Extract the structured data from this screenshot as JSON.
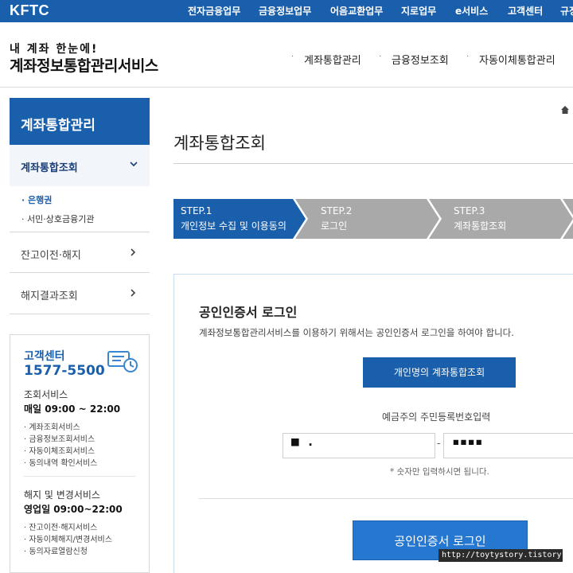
{
  "topbar": {
    "logo": "KFTC",
    "nav": [
      "전자금융업무",
      "금융정보업무",
      "어음교환업무",
      "지로업무",
      "e서비스",
      "고객센터",
      "규정"
    ]
  },
  "header": {
    "slogan": "내 계좌 한눈에!",
    "title": "계좌정보통합관리서비스",
    "nav": [
      "계좌통합관리",
      "금융정보조회",
      "자동이체통합관리"
    ]
  },
  "sidebar": {
    "heading": "계좌통합관리",
    "active_item": "계좌통합조회",
    "sub_items": [
      "은행권",
      "서민·상호금융기관"
    ],
    "menu": [
      "잔고이전·해지",
      "해지결과조회"
    ]
  },
  "customer_center": {
    "title": "고객센터",
    "phone": "1577-5500",
    "inquiry_title": "조회서비스",
    "inquiry_hours": "매일 09:00 ~ 22:00",
    "inquiry_items": [
      "계좌조회서비스",
      "금융정보조회서비스",
      "자동이체조회서비스",
      "동의내역 확인서비스"
    ],
    "change_title": "해지 및 변경서비스",
    "change_hours": "영업일 09:00~22:00",
    "change_items": [
      "잔고이전·해지서비스",
      "자동이체해지/변경서비스",
      "동의자료열람신청"
    ]
  },
  "main": {
    "title": "계좌통합조회",
    "steps": [
      {
        "label": "STEP.1",
        "desc": "개인정보 수집 및 이용동의",
        "active": true
      },
      {
        "label": "STEP.2",
        "desc": "로그인",
        "active": false
      },
      {
        "label": "STEP.3",
        "desc": "계좌통합조회",
        "active": false
      }
    ],
    "login": {
      "title": "공인인증서 로그인",
      "description": "계좌정보통합관리서비스를 이용하기 위해서는 공인인증서 로그인을 하여야 합니다.",
      "personal_button": "개인명의 계좌통합조회",
      "field_label": "예금주의 주민등록번호입력",
      "rrn_front": "■ .",
      "rrn_back": "▪▪▪▪",
      "rrn_separator": "-",
      "hint": "* 숫자만 입력하시면 됩니다.",
      "login_button": "공인인증서 로그인"
    }
  },
  "watermark": "http://toytystory.tistory.com",
  "colors": {
    "primary": "#1a5fab",
    "button_blue": "#2577cf",
    "step_inactive": "#a9a9a9"
  }
}
